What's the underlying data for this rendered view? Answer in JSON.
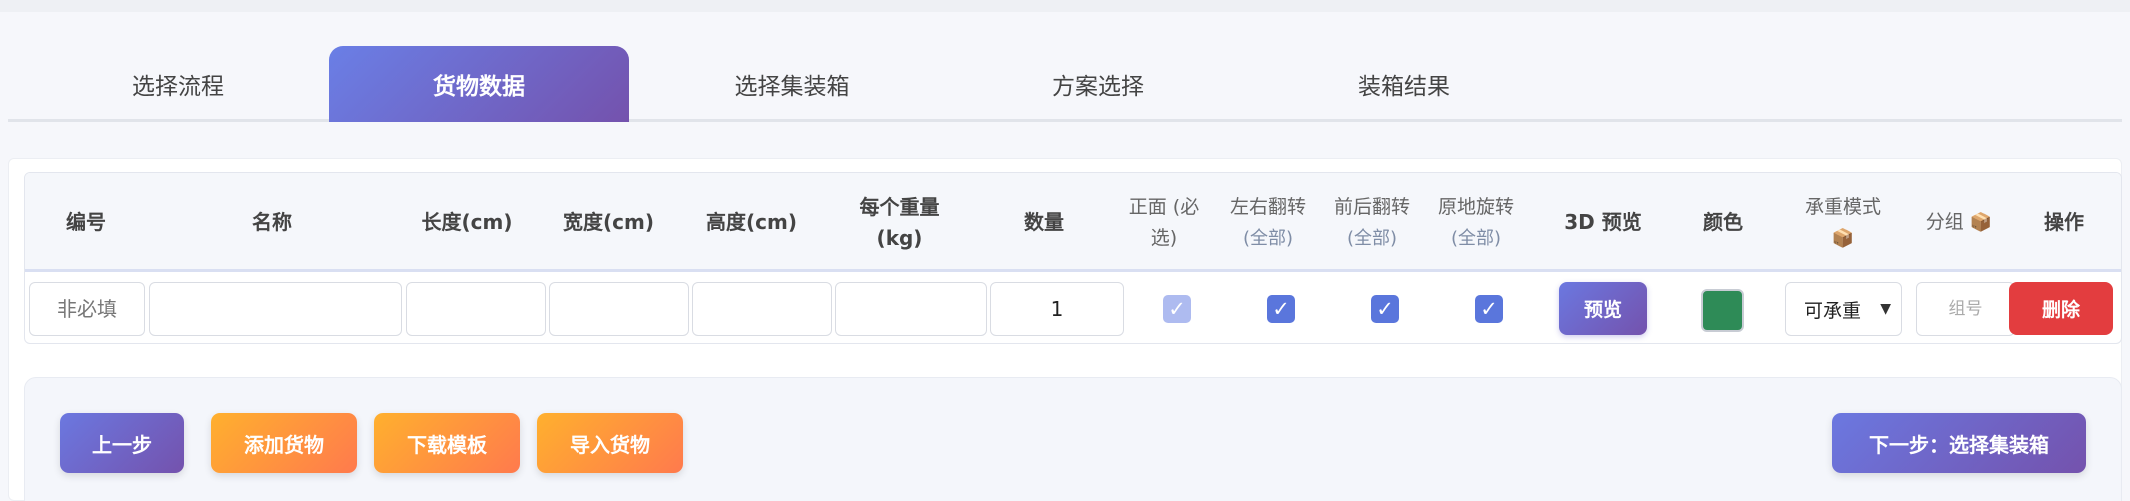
{
  "tabs": [
    {
      "label": "选择流程",
      "active": false
    },
    {
      "label": "货物数据",
      "active": true
    },
    {
      "label": "选择集装箱",
      "active": false
    },
    {
      "label": "方案选择",
      "active": false
    },
    {
      "label": "装箱结果",
      "active": false
    }
  ],
  "table": {
    "headers": {
      "id": "编号",
      "name": "名称",
      "length": "长度(cm)",
      "width": "宽度(cm)",
      "height": "高度(cm)",
      "weight_line1": "每个重量",
      "weight_line2": "(kg)",
      "qty": "数量",
      "front_line1": "正面 (必",
      "front_line2": "选)",
      "lr_flip": "左右翻转",
      "lr_flip_all": "(全部)",
      "fb_flip": "前后翻转",
      "fb_flip_all": "(全部)",
      "rotate": "原地旋转",
      "rotate_all": "(全部)",
      "preview3d": "3D 预览",
      "color": "颜色",
      "load_mode": "承重模式",
      "group": "分组",
      "ops": "操作"
    },
    "row": {
      "id_placeholder": "非必填",
      "name_value": "",
      "length_value": "",
      "width_value": "",
      "height_value": "",
      "weight_value": "",
      "qty_value": "1",
      "front_checked": true,
      "lr_checked": true,
      "fb_checked": true,
      "rotate_checked": true,
      "preview_label": "预览",
      "color": "#2e8b57",
      "load_mode_selected": "可承重",
      "group_placeholder": "组号",
      "delete_label": "删除"
    }
  },
  "actions": {
    "prev": "上一步",
    "add": "添加货物",
    "download_template": "下载模板",
    "import": "导入货物",
    "next": "下一步：选择集装箱"
  },
  "colors": {
    "accent_start": "#6a7fe6",
    "accent_end": "#7452ad",
    "orange_start": "#ffb02e",
    "orange_end": "#ff7a4d",
    "danger": "#e33d3f",
    "checkbox": "#5a76dc"
  }
}
